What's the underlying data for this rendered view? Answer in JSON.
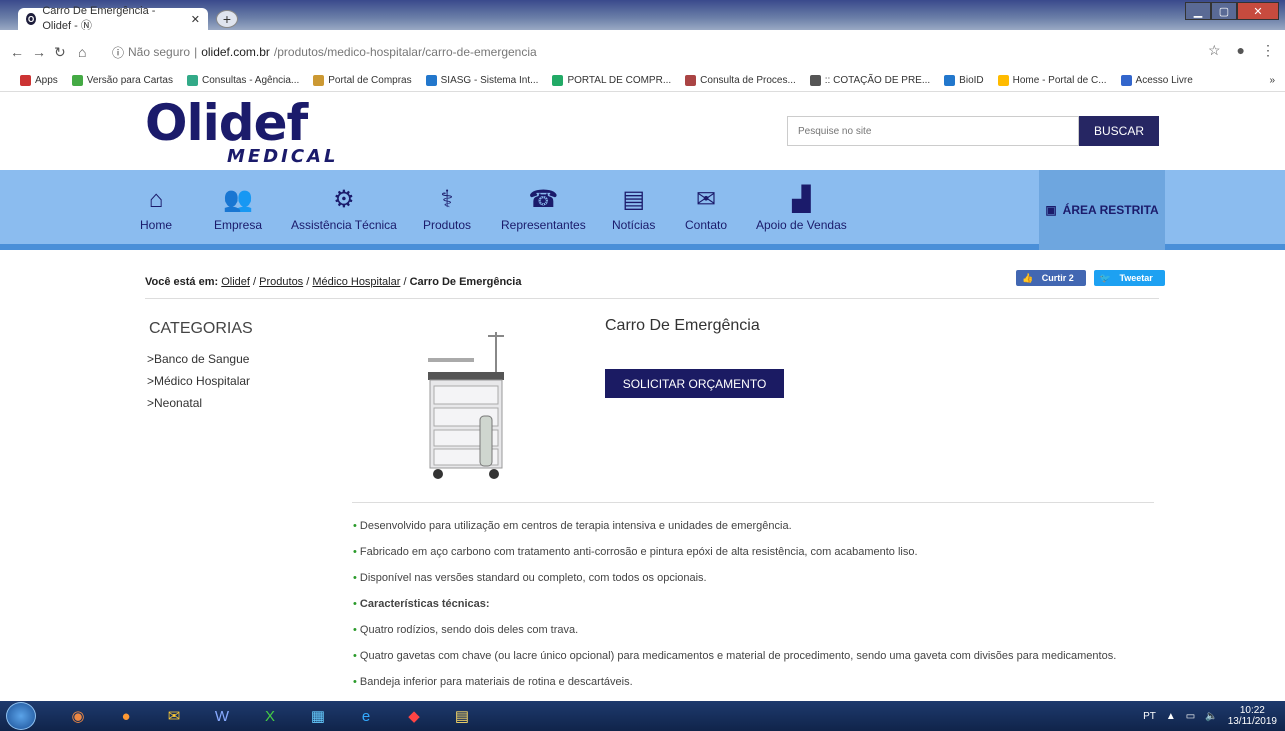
{
  "browser": {
    "tab_title": "Carro De Emergência - Olidef - Ⓝ",
    "security_label": "Não seguro",
    "url_host": "olidef.com.br",
    "url_path": "/produtos/medico-hospitalar/carro-de-emergencia",
    "bookmarks": [
      "Apps",
      "Versão para Cartas",
      "Consultas - Agência...",
      "Portal de Compras",
      "SIASG - Sistema Int...",
      "PORTAL DE COMPR...",
      "Consulta de Proces...",
      ":: COTAÇÃO DE PRE...",
      "BioID",
      "Home - Portal de C...",
      "Acesso Livre"
    ],
    "more_bookmarks": "»"
  },
  "header": {
    "logo_main": "Olidef",
    "logo_sub": "MEDICAL",
    "search_placeholder": "Pesquise no site",
    "search_button": "BUSCAR"
  },
  "nav": {
    "items": [
      {
        "label": "Home",
        "icon": "home-icon"
      },
      {
        "label": "Empresa",
        "icon": "people-icon"
      },
      {
        "label": "Assistência Técnica",
        "icon": "technician-icon"
      },
      {
        "label": "Produtos",
        "icon": "stethoscope-icon"
      },
      {
        "label": "Representantes",
        "icon": "representative-icon"
      },
      {
        "label": "Notícias",
        "icon": "newspaper-icon"
      },
      {
        "label": "Contato",
        "icon": "mail-icon"
      },
      {
        "label": "Apoio de Vendas",
        "icon": "chart-icon"
      }
    ],
    "restricted": "ÁREA RESTRITA"
  },
  "breadcrumb": {
    "prefix": "Você está em:",
    "links": [
      "Olidef",
      "Produtos",
      "Médico Hospitalar"
    ],
    "current": "Carro De Emergência"
  },
  "social": {
    "like": "Curtir 2",
    "tweet": "Tweetar"
  },
  "categories": {
    "title": "CATEGORIAS",
    "items": [
      ">Banco de Sangue",
      ">Médico Hospitalar",
      ">Neonatal"
    ]
  },
  "product": {
    "title": "Carro De Emergência",
    "quote_button": "SOLICITAR ORÇAMENTO"
  },
  "features": [
    "Desenvolvido para utilização em centros de terapia intensiva e unidades de emergência.",
    "Fabricado em aço carbono com tratamento anti-corrosão e pintura epóxi de alta resistência, com acabamento liso.",
    "Disponível nas versões standard ou completo, com todos os opcionais.",
    "Características técnicas:",
    "Quatro rodízios, sendo dois deles com trava.",
    "Quatro gavetas com chave (ou lacre único opcional) para medicamentos e material de procedimento, sendo uma gaveta com divisões para medicamentos.",
    "Bandeja inferior para materiais de rotina e descartáveis."
  ],
  "taskbar": {
    "lang": "PT",
    "time": "10:22",
    "date": "13/11/2019"
  }
}
